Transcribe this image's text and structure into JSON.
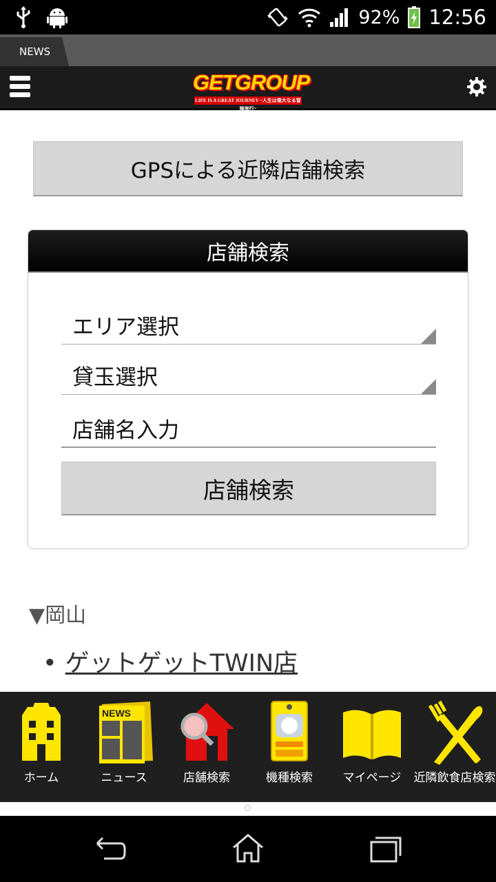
{
  "status_bar": {
    "battery": "92%",
    "time": "12:56"
  },
  "tab": {
    "label": "NEWS"
  },
  "header": {
    "logo_text": "GETGROUP",
    "logo_tagline": "LIFE IS A GREAT JOURNEY ~人生は偉大なる冒険旅行~"
  },
  "gps_button": {
    "label": "GPSによる近隣店舗検索"
  },
  "search_panel": {
    "title": "店舗検索",
    "area_select": "エリア選択",
    "ball_select": "貸玉選択",
    "name_input_placeholder": "店舗名入力",
    "search_button": "店舗検索"
  },
  "results": {
    "region": "▼岡山",
    "stores": [
      "ゲットゲットTWIN店"
    ]
  },
  "bottom_nav": [
    {
      "label": "ホーム",
      "icon": "home-building-icon"
    },
    {
      "label": "ニュース",
      "icon": "newspaper-icon"
    },
    {
      "label": "店舗検索",
      "icon": "store-search-icon"
    },
    {
      "label": "機種検索",
      "icon": "pachinko-machine-icon"
    },
    {
      "label": "マイページ",
      "icon": "open-book-icon"
    },
    {
      "label": "近隣飲食店検索",
      "icon": "fork-knife-icon"
    }
  ],
  "colors": {
    "accent_yellow": "#ffe600",
    "logo_red": "#d40000",
    "nav_background": "#1f1f1f"
  }
}
